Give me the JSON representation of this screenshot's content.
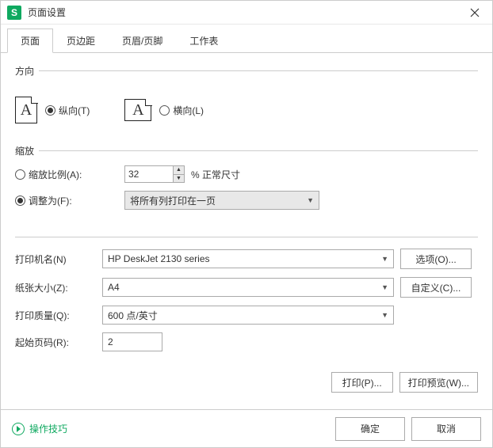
{
  "window": {
    "logo": "S",
    "title": "页面设置"
  },
  "tabs": [
    "页面",
    "页边距",
    "页眉/页脚",
    "工作表"
  ],
  "groups": {
    "orientation": "方向",
    "scale": "缩放"
  },
  "orientation": {
    "portrait": "纵向(T)",
    "landscape": "横向(L)",
    "selected": "portrait"
  },
  "scale": {
    "ratio_label": "缩放比例(A):",
    "ratio_value": "32",
    "ratio_suffix": "% 正常尺寸",
    "fit_label": "调整为(F):",
    "fit_value": "将所有列打印在一页",
    "selected": "fit"
  },
  "printer": {
    "name_label": "打印机名(N)",
    "name_value": "HP DeskJet 2130 series",
    "options_btn": "选项(O)...",
    "paper_label": "纸张大小(Z):",
    "paper_value": "A4",
    "custom_btn": "自定义(C)...",
    "quality_label": "打印质量(Q):",
    "quality_value": "600 点/英寸",
    "startpage_label": "起始页码(R):",
    "startpage_value": "2"
  },
  "actions": {
    "print": "打印(P)...",
    "preview": "打印预览(W)...",
    "tips": "操作技巧",
    "ok": "确定",
    "cancel": "取消"
  }
}
